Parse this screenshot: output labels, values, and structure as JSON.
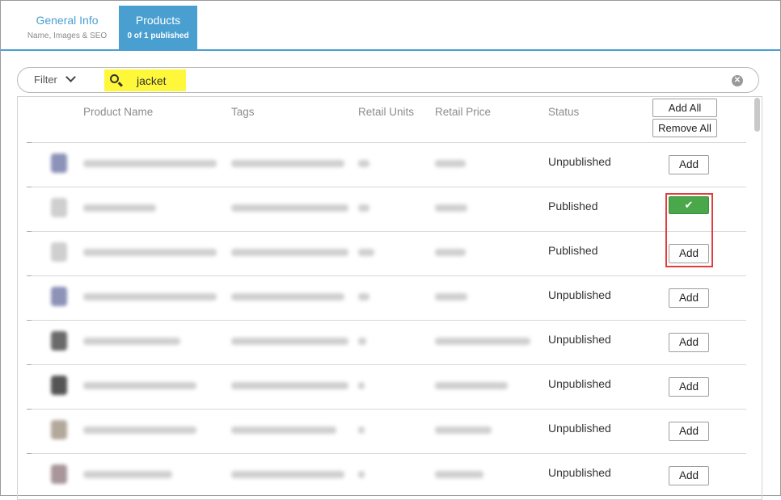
{
  "tabs": [
    {
      "title": "General Info",
      "subtitle": "Name, Images & SEO"
    },
    {
      "title": "Products",
      "subtitle": "0 of 1 published"
    }
  ],
  "filter": {
    "label": "Filter",
    "search_value": "jacket"
  },
  "table": {
    "headers": {
      "product_name": "Product Name",
      "tags": "Tags",
      "retail_units": "Retail Units",
      "retail_price": "Retail Price",
      "status": "Status"
    },
    "add_all_label": "Add All",
    "remove_all_label": "Remove All",
    "add_label": "Add",
    "rows": [
      {
        "status": "Unpublished",
        "action": "Add"
      },
      {
        "status": "Published",
        "action": "✔"
      },
      {
        "status": "Published",
        "action": "Add"
      },
      {
        "status": "Unpublished",
        "action": "Add"
      },
      {
        "status": "Unpublished",
        "action": "Add"
      },
      {
        "status": "Unpublished",
        "action": "Add"
      },
      {
        "status": "Unpublished",
        "action": "Add"
      },
      {
        "status": "Unpublished",
        "action": "Add"
      }
    ]
  },
  "colors": {
    "accent": "#4a9fd1",
    "published": "#4aa84a",
    "search_highlight": "#fff83a",
    "annotation": "#e23c3c"
  }
}
